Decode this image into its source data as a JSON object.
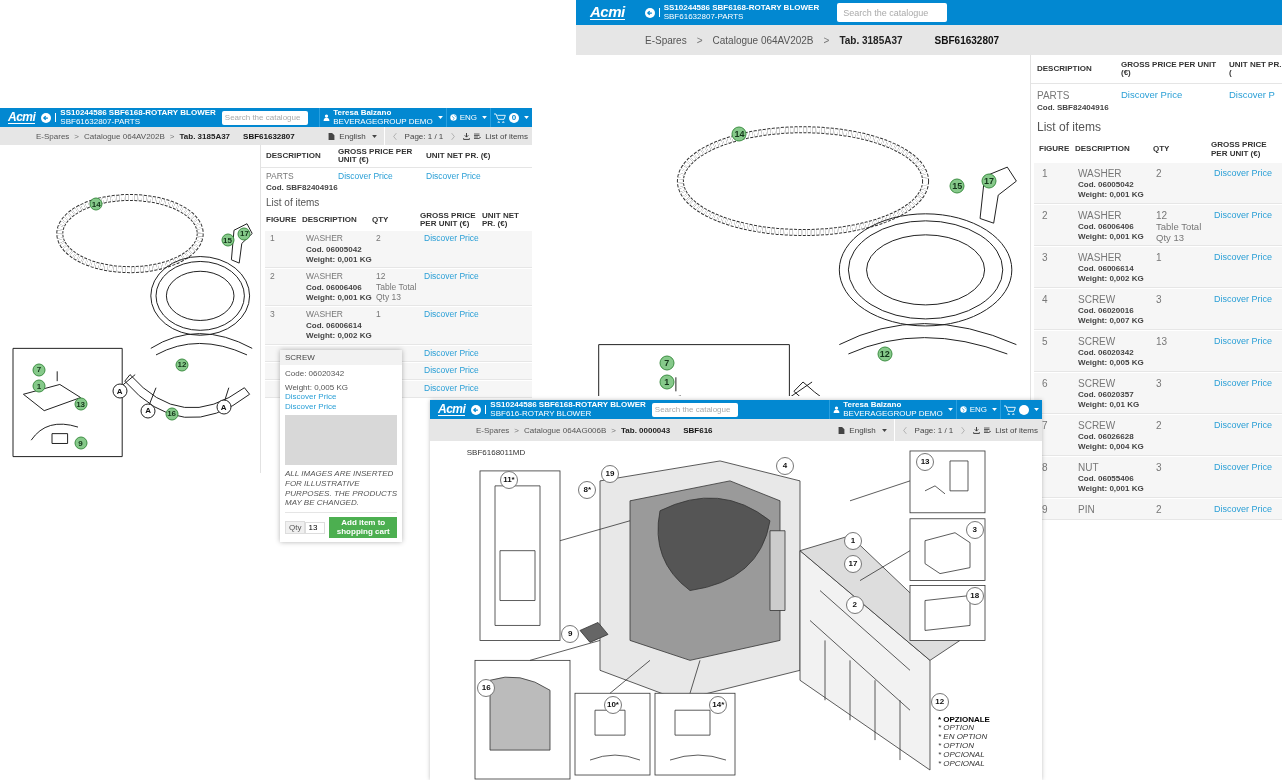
{
  "screens": [
    {
      "logo": "Acmi",
      "title": "SS10244586 SBF6168-ROTARY BLOWER",
      "subtitle": "SBF61632807-PARTS",
      "search": {
        "placeholder": "Search the catalogue"
      },
      "user": {
        "name": "Teresa Balzano",
        "company": "BEVERAGEGROUP DEMO"
      },
      "language": "ENG",
      "cart_count": "0",
      "breadcrumb": [
        "E-Spares",
        "Catalogue 064AV202B",
        "Tab. 3185A37"
      ],
      "separator": ">",
      "current": "SBF61632807",
      "toolbar": {
        "language": "English",
        "page": "Page: 1 / 1",
        "list_button": "List of items"
      },
      "drawing": {
        "kind": "parts",
        "callouts": [
          {
            "label": "14",
            "kind": "part"
          },
          {
            "label": "15",
            "kind": "part"
          },
          {
            "label": "17",
            "kind": "part"
          },
          {
            "label": "12",
            "kind": "part"
          },
          {
            "label": "16",
            "kind": "part"
          },
          {
            "label": "A",
            "kind": "view"
          },
          {
            "label": "A",
            "kind": "view"
          },
          {
            "label": "A",
            "kind": "view"
          },
          {
            "label": "7",
            "kind": "part"
          },
          {
            "label": "1",
            "kind": "part"
          },
          {
            "label": "13",
            "kind": "part"
          },
          {
            "label": "9",
            "kind": "part"
          }
        ]
      },
      "parts_table": {
        "columns": [
          "DESCRIPTION",
          "GROSS PRICE PER UNIT (€)",
          "UNIT NET PR. (€)"
        ],
        "rows": [
          {
            "description": "PARTS",
            "code": "Cod. SBF82404916",
            "gross": "Discover Price",
            "net": "Discover Price"
          }
        ]
      },
      "items": {
        "title": "List of items",
        "columns": [
          "FIGURE",
          "DESCRIPTION",
          "QTY",
          "GROSS PRICE PER UNIT (€)",
          "UNIT NET PR. (€)"
        ],
        "rows": [
          {
            "figure": "1",
            "description": "WASHER",
            "code": "Cod. 06005042",
            "weight": "Weight: 0,001 KG",
            "qty": "2",
            "gross": "Discover Price"
          },
          {
            "figure": "2",
            "description": "WASHER",
            "code": "Cod. 06006406",
            "weight": "Weight: 0,001 KG",
            "qty": "12",
            "qty_note": "Table Total Qty 13",
            "gross": "Discover Price"
          },
          {
            "figure": "3",
            "description": "WASHER",
            "code": "Cod. 06006614",
            "weight": "Weight: 0,002 KG",
            "qty": "1",
            "gross": "Discover Price"
          },
          {
            "gross": "Discover Price"
          },
          {
            "gross": "Discover Price"
          },
          {
            "gross": "Discover Price"
          }
        ]
      },
      "popup": {
        "title": "SCREW",
        "code": "Code: 06020342",
        "weight": "Weight: 0,005 KG",
        "links": [
          "Discover Price",
          "Discover Price"
        ],
        "note": "ALL IMAGES ARE INSERTED FOR ILLUSTRATIVE PURPOSES. THE PRODUCTS MAY BE CHANGED.",
        "qty_label": "Qty",
        "qty": "13",
        "button": "Add item to shopping cart"
      }
    },
    {
      "logo": "Acmi",
      "title": "SS10244586 SBF6168-ROTARY BLOWER",
      "subtitle": "SBF61632807-PARTS",
      "search": {
        "placeholder": "Search the catalogue"
      },
      "breadcrumb": [
        "E-Spares",
        "Catalogue 064AV202B",
        "Tab. 3185A37"
      ],
      "separator": ">",
      "current": "SBF61632807",
      "drawing": {
        "kind": "parts",
        "callouts": [
          {
            "label": "14",
            "kind": "part"
          },
          {
            "label": "15",
            "kind": "part"
          },
          {
            "label": "17",
            "kind": "part"
          },
          {
            "label": "12",
            "kind": "part"
          },
          {
            "label": "7",
            "kind": "part"
          },
          {
            "label": "1",
            "kind": "part"
          }
        ]
      },
      "parts_table": {
        "columns": [
          "DESCRIPTION",
          "GROSS PRICE PER UNIT (€)",
          "UNIT NET PR. ("
        ],
        "rows": [
          {
            "description": "PARTS",
            "code": "Cod. SBF82404916",
            "gross": "Discover Price",
            "net": "Discover P"
          }
        ]
      },
      "items": {
        "title": "List of items",
        "columns": [
          "FIGURE",
          "DESCRIPTION",
          "QTY",
          "GROSS PRICE PER UNIT (€)"
        ],
        "rows": [
          {
            "figure": "1",
            "description": "WASHER",
            "code": "Cod. 06005042",
            "weight": "Weight: 0,001 KG",
            "qty": "2",
            "gross": "Discover Price"
          },
          {
            "figure": "2",
            "description": "WASHER",
            "code": "Cod. 06006406",
            "weight": "Weight: 0,001 KG",
            "qty": "12",
            "qty_note": "Table Total Qty 13",
            "gross": "Discover Price"
          },
          {
            "figure": "3",
            "description": "WASHER",
            "code": "Cod. 06006614",
            "weight": "Weight: 0,002 KG",
            "qty": "1",
            "gross": "Discover Price"
          },
          {
            "figure": "4",
            "description": "SCREW",
            "code": "Cod. 06020016",
            "weight": "Weight: 0,007 KG",
            "qty": "3",
            "gross": "Discover Price"
          },
          {
            "figure": "5",
            "description": "SCREW",
            "code": "Cod. 06020342",
            "weight": "Weight: 0,005 KG",
            "qty": "13",
            "gross": "Discover Price"
          },
          {
            "figure": "6",
            "description": "SCREW",
            "code": "Cod. 06020357",
            "weight": "Weight: 0,01 KG",
            "qty": "3",
            "gross": "Discover Price"
          },
          {
            "figure": "7",
            "description": "SCREW",
            "code": "Cod. 06026628",
            "weight": "Weight: 0,004 KG",
            "qty": "2",
            "gross": "Discover Price"
          },
          {
            "figure": "8",
            "description": "NUT",
            "code": "Cod. 06055406",
            "weight": "Weight: 0,001 KG",
            "qty": "3",
            "gross": "Discover Price"
          },
          {
            "figure": "9",
            "description": "PIN",
            "qty": "2",
            "gross": "Discover Price"
          }
        ]
      }
    },
    {
      "logo": "Acmi",
      "title": "SS10244586 SBF6168-ROTARY BLOWER",
      "subtitle": "SBF616-ROTARY BLOWER",
      "search": {
        "placeholder": "Search the catalogue"
      },
      "user": {
        "name": "Teresa Balzano",
        "company": "BEVERAGEGROUP DEMO"
      },
      "language": "ENG",
      "breadcrumb": [
        "E-Spares",
        "Catalogue 064AG006B",
        "Tab. 0000043"
      ],
      "separator": ">",
      "current": "SBF616",
      "toolbar": {
        "language": "English",
        "page": "Page: 1 / 1",
        "list_button": "List of items"
      },
      "drawing": {
        "kind": "machine",
        "label": "SBF6168011MD",
        "callouts": [
          {
            "label": "11*",
            "kind": "item"
          },
          {
            "label": "8*",
            "kind": "item"
          },
          {
            "label": "19",
            "kind": "item"
          },
          {
            "label": "4",
            "kind": "item"
          },
          {
            "label": "1",
            "kind": "item"
          },
          {
            "label": "17",
            "kind": "item"
          },
          {
            "label": "2",
            "kind": "item"
          },
          {
            "label": "12",
            "kind": "item"
          },
          {
            "label": "9",
            "kind": "item"
          },
          {
            "label": "16",
            "kind": "item"
          },
          {
            "label": "10*",
            "kind": "item"
          },
          {
            "label": "14*",
            "kind": "item"
          },
          {
            "label": "13",
            "kind": "item"
          },
          {
            "label": "3",
            "kind": "item"
          },
          {
            "label": "18",
            "kind": "item"
          }
        ],
        "legend": [
          "* OPZIONALE",
          "* OPTION",
          "* EN OPTION",
          "* OPTION",
          "* OPCIONAL",
          "* OPCIONAL"
        ]
      }
    }
  ]
}
